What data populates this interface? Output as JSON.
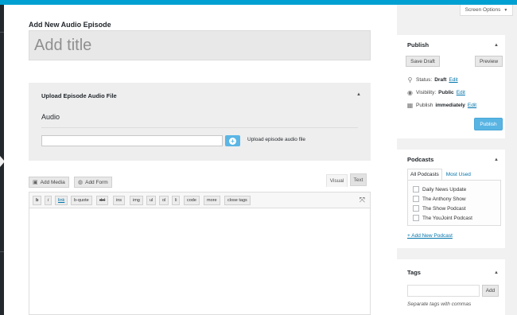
{
  "header": {
    "page_title": "Add New Audio Episode",
    "title_placeholder": "Add title",
    "screen_options_label": "Screen Options",
    "screen_options_icon": "caret-down-icon"
  },
  "upload": {
    "heading": "Upload Episode Audio File",
    "field_label": "Audio",
    "file_value": "",
    "button_label": "Upload episode audio file"
  },
  "editor": {
    "add_media_label": "Add Media",
    "add_form_label": "Add Form",
    "tab_visual": "Visual",
    "tab_text": "Text",
    "quicktags": [
      "b",
      "i",
      "link",
      "b-quote",
      "del",
      "ins",
      "img",
      "ul",
      "ol",
      "li",
      "code",
      "more",
      "close tags"
    ]
  },
  "publish": {
    "title": "Publish",
    "save_draft": "Save Draft",
    "preview": "Preview",
    "status_label": "Status:",
    "status_value": "Draft",
    "visibility_label": "Visibility:",
    "visibility_value": "Public",
    "schedule_label": "Publish",
    "schedule_value": "immediately",
    "edit_label": "Edit",
    "publish_button": "Publish"
  },
  "podcasts": {
    "title": "Podcasts",
    "tab_all": "All Podcasts",
    "tab_most_used": "Most Used",
    "items": [
      "Daily News Update",
      "The Anthony Show",
      "The Show Podcast",
      "The YouJoint Podcast"
    ],
    "add_new": "+ Add New Podcast"
  },
  "tags": {
    "title": "Tags",
    "input_value": "",
    "add_button": "Add",
    "hint": "Separate tags with commas"
  },
  "colors": {
    "accent": "#00a0d2",
    "primary_button": "#58b4e3",
    "link": "#0073aa"
  }
}
